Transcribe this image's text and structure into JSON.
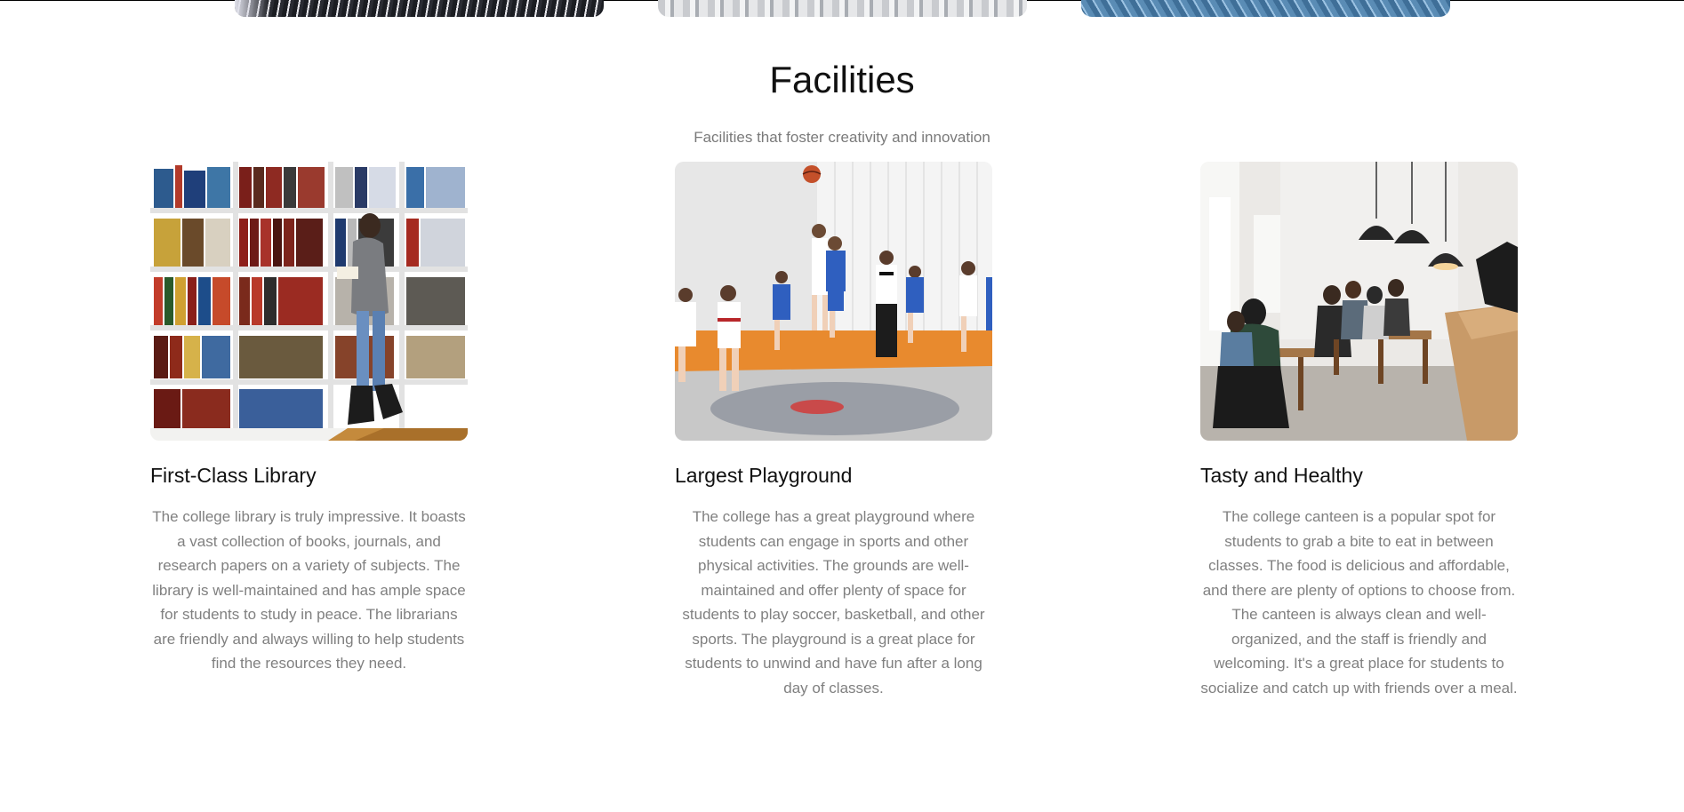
{
  "section": {
    "title": "Facilities",
    "subtitle": "Facilities that foster creativity and innovation"
  },
  "cards": [
    {
      "image_alt": "library-photo",
      "title": "First-Class Library",
      "text": "The college library is truly impressive. It boasts a vast collection of books, journals, and research papers on a variety of subjects. The library is well-maintained and has ample space for students to study in peace. The librarians are friendly and always willing to help students find the resources they need."
    },
    {
      "image_alt": "playground-photo",
      "title": "Largest Playground",
      "text": "The college has a great playground where students can engage in sports and other physical activities. The grounds are well-maintained and offer plenty of space for students to play soccer, basketball, and other sports. The playground is a great place for students to unwind and have fun after a long day of classes."
    },
    {
      "image_alt": "canteen-photo",
      "title": "Tasty and Healthy",
      "text": "The college canteen is a popular spot for students to grab a bite to eat in between classes. The food is delicious and affordable, and there are plenty of options to choose from. The canteen is always clean and well-organized, and the staff is friendly and welcoming. It's a great place for students to socialize and catch up with friends over a meal."
    }
  ]
}
